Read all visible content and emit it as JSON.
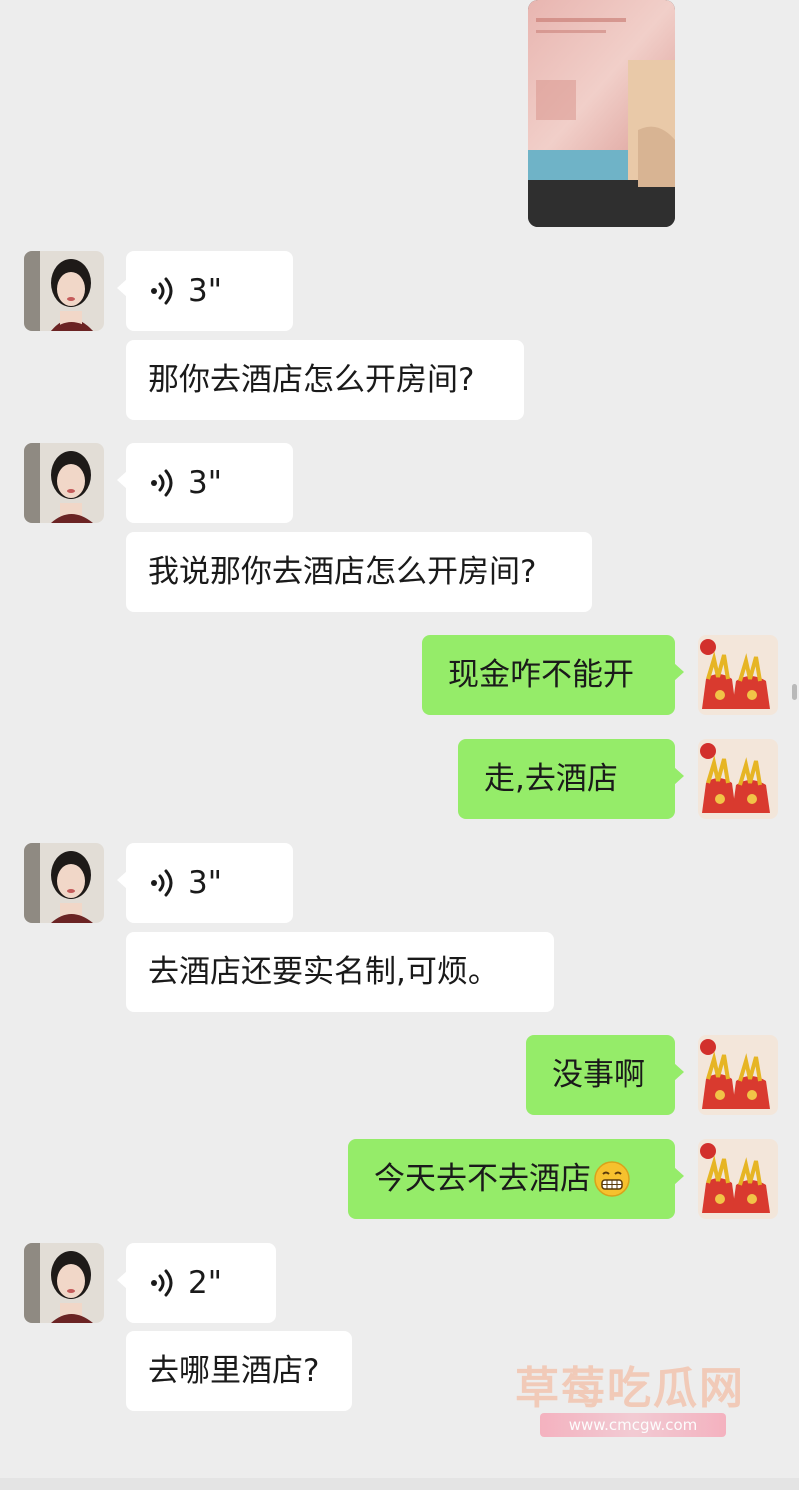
{
  "colors": {
    "background": "#ededed",
    "incoming_bubble": "#ffffff",
    "outgoing_bubble": "#95ec69",
    "text": "#1a1a1a"
  },
  "messages": [
    {
      "id": "m1",
      "sender": "contact",
      "type": "voice",
      "duration": "3\""
    },
    {
      "id": "m2",
      "sender": "contact",
      "type": "text",
      "text": "那你去酒店怎么开房间?"
    },
    {
      "id": "m3",
      "sender": "contact",
      "type": "voice",
      "duration": "3\""
    },
    {
      "id": "m4",
      "sender": "contact",
      "type": "text",
      "text": "我说那你去酒店怎么开房间?"
    },
    {
      "id": "m5",
      "sender": "me",
      "type": "text",
      "text": "现金咋不能开"
    },
    {
      "id": "m6",
      "sender": "me",
      "type": "text",
      "text": "走,去酒店"
    },
    {
      "id": "m7",
      "sender": "contact",
      "type": "voice",
      "duration": "3\""
    },
    {
      "id": "m8",
      "sender": "contact",
      "type": "text",
      "text": "去酒店还要实名制,可烦。"
    },
    {
      "id": "m9",
      "sender": "me",
      "type": "text",
      "text": "没事啊"
    },
    {
      "id": "m10",
      "sender": "me",
      "type": "text",
      "text": "今天去不去酒店",
      "emoji": "grin-emoji"
    },
    {
      "id": "m11",
      "sender": "contact",
      "type": "voice",
      "duration": "2\""
    },
    {
      "id": "m12",
      "sender": "contact",
      "type": "text",
      "text": "去哪里酒店?"
    }
  ],
  "watermark": {
    "title": "草莓吃瓜网",
    "url": "www.cmcgw.com"
  }
}
